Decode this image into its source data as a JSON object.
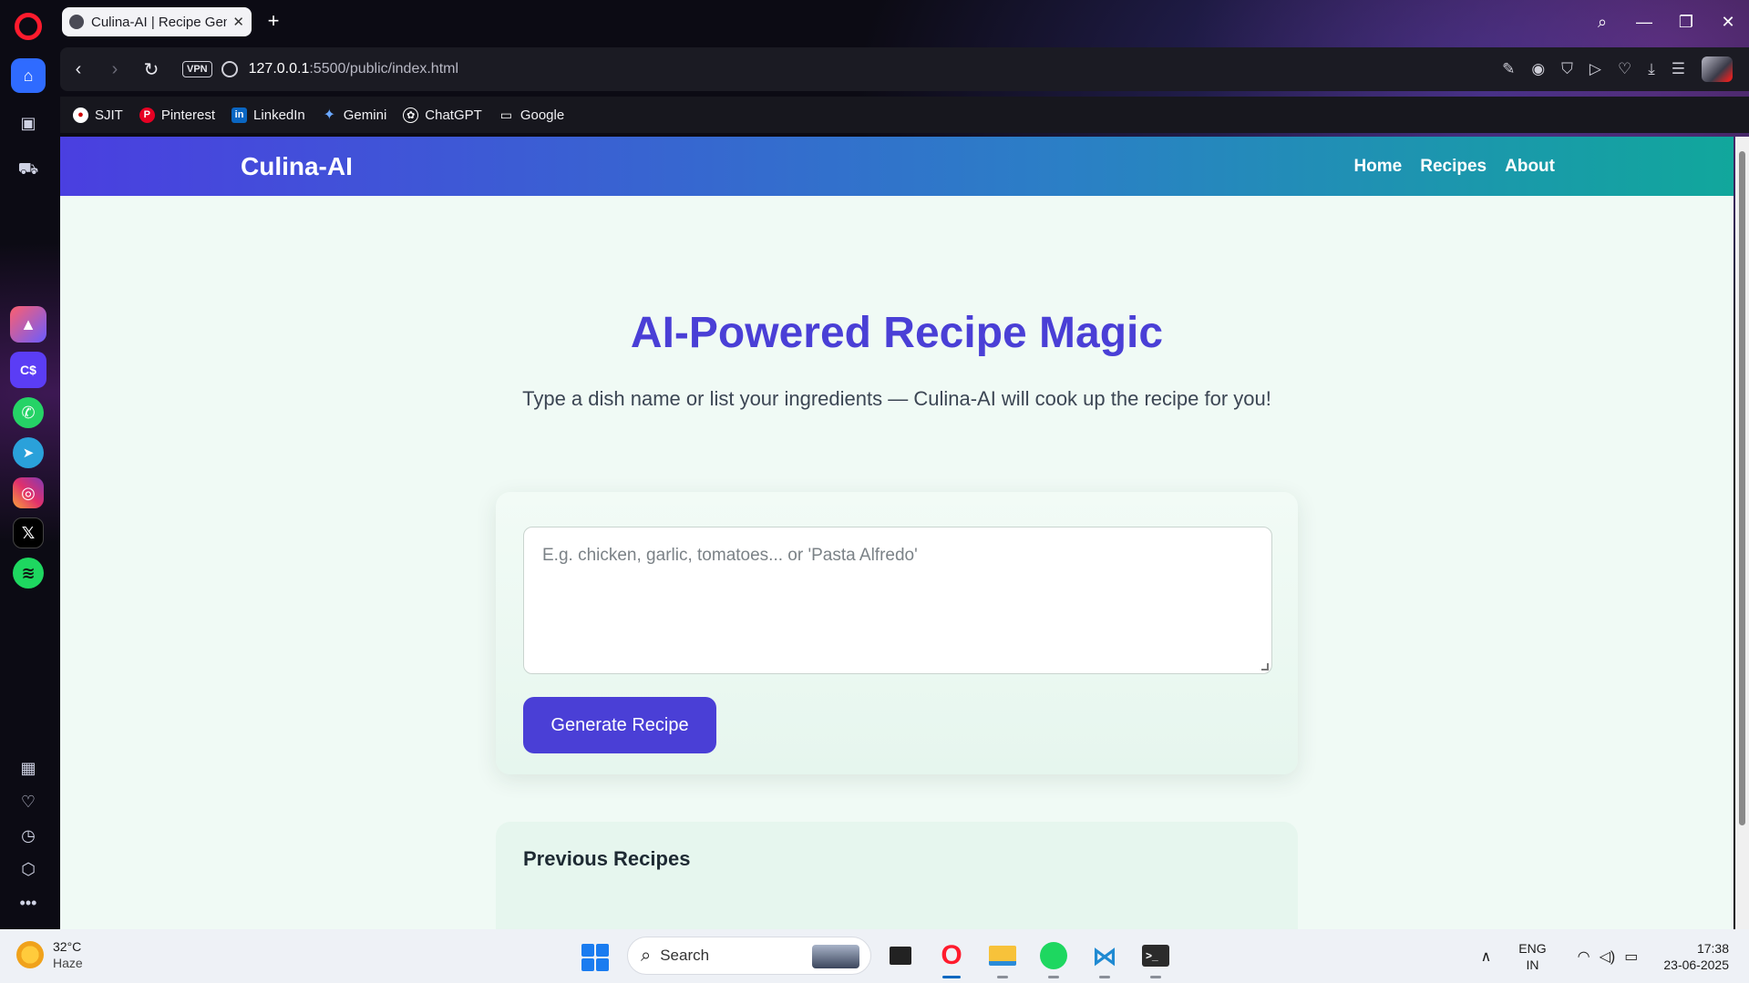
{
  "browser": {
    "tab": {
      "title": "Culina-AI | Recipe Generator"
    },
    "address": {
      "host": "127.0.0.1",
      "path": ":5500/public/index.html"
    },
    "vpn_label": "VPN",
    "bookmarks": [
      "SJIT",
      "Pinterest",
      "LinkedIn",
      "Gemini",
      "ChatGPT",
      "Google"
    ]
  },
  "page": {
    "brand": "Culina-AI",
    "nav": [
      "Home",
      "Recipes",
      "About"
    ],
    "hero": {
      "title": "AI-Powered Recipe Magic",
      "subtitle": "Type a dish name or list your ingredients — Culina-AI will cook up the recipe for you!"
    },
    "form": {
      "placeholder": "E.g. chicken, garlic, tomatoes... or 'Pasta Alfredo'",
      "value": "",
      "button_label": "Generate Recipe"
    },
    "previous": {
      "heading": "Previous Recipes"
    }
  },
  "taskbar": {
    "weather": {
      "temp": "32°C",
      "condition": "Haze"
    },
    "search_label": "Search",
    "lang": {
      "line1": "ENG",
      "line2": "IN"
    },
    "clock": {
      "time": "17:38",
      "date": "23-06-2025"
    }
  },
  "colors": {
    "accent": "#4a3fd6",
    "header_gradient_start": "#4a3fe0",
    "header_gradient_end": "#11a79c",
    "page_bg": "#f0faf5"
  },
  "icons": {
    "sidebar": [
      "home-icon",
      "game-controller-icon",
      "car-icon",
      "aria-icon",
      "cs-app-icon",
      "whatsapp-icon",
      "telegram-icon",
      "instagram-icon",
      "x-icon",
      "spotify-icon",
      "grid-icon",
      "heart-icon",
      "history-icon",
      "cube-icon",
      "more-icon"
    ]
  }
}
